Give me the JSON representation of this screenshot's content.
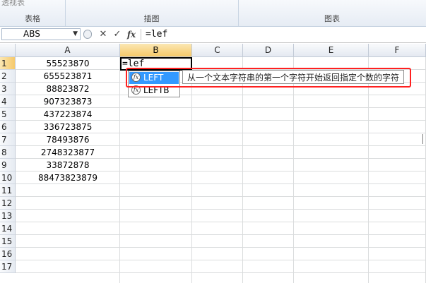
{
  "ribbon": {
    "partial_top_label": "透视表",
    "groups": [
      {
        "label": "表格"
      },
      {
        "label": "插图"
      },
      {
        "label": ""
      },
      {
        "label": "图表"
      }
    ]
  },
  "formula_bar": {
    "name_box": "ABS",
    "cancel_glyph": "✕",
    "enter_glyph": "✓",
    "fx_glyph": "fx",
    "content": "=lef"
  },
  "columns": [
    "A",
    "B",
    "C",
    "D",
    "E",
    "F"
  ],
  "rows": [
    "1",
    "2",
    "3",
    "4",
    "5",
    "6",
    "7",
    "8",
    "9",
    "10",
    "11",
    "12",
    "13",
    "14",
    "15",
    "16",
    "17"
  ],
  "column_a_values": [
    "55523870",
    "655523871",
    "88823872",
    "907323873",
    "437223874",
    "336723875",
    "78493876",
    "2748323877",
    "33872878",
    "88473823879"
  ],
  "active_cell_text": "=lef",
  "autocomplete": {
    "items": [
      {
        "label": "LEFT",
        "selected": true
      },
      {
        "label": "LEFTB",
        "selected": false
      }
    ],
    "icon_glyph": "fx",
    "tooltip": "从一个文本字符串的第一个字符开始返回指定个数的字符"
  },
  "colors": {
    "selection_blue": "#3399ff",
    "highlight_red": "#ff2020",
    "header_selected": "#f6c96a"
  }
}
